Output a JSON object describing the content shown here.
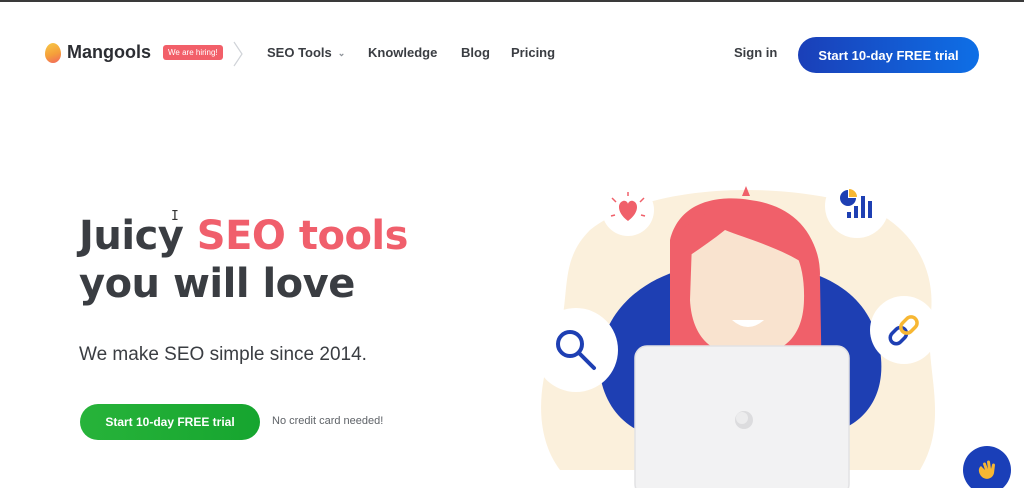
{
  "brand": {
    "name": "Mangools",
    "hiring_badge": "We are hiring!"
  },
  "nav": {
    "items": [
      {
        "label": "SEO Tools",
        "has_dropdown": true
      },
      {
        "label": "Knowledge"
      },
      {
        "label": "Blog"
      },
      {
        "label": "Pricing"
      }
    ],
    "sign_in": "Sign in",
    "cta": "Start 10-day FREE trial"
  },
  "hero": {
    "title_line1_plain": "Juicy ",
    "title_line1_accent": "SEO tools",
    "title_line2": "you will love",
    "subtitle": "We make SEO simple since 2014.",
    "cta": "Start 10-day FREE trial",
    "note": "No credit card needed!"
  },
  "icons": [
    "heart-icon",
    "chart-icon",
    "search-icon",
    "link-icon",
    "wave-hand-icon",
    "chevron-down-icon"
  ],
  "colors": {
    "accent_red": "#f05f6c",
    "brand_blue": "#1a3fb8",
    "cta_green": "#27b33a",
    "text_dark": "#3a3d42"
  }
}
